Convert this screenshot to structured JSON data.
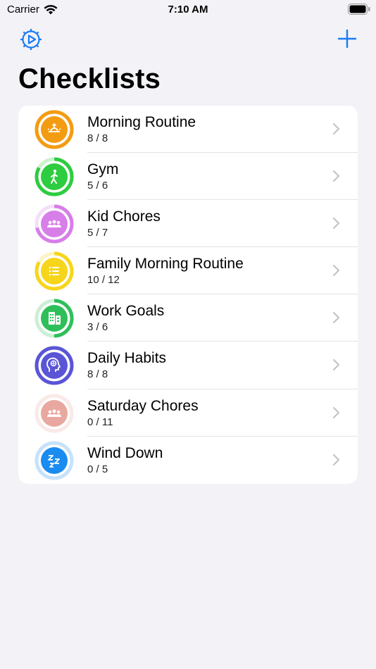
{
  "status": {
    "carrier": "Carrier",
    "time": "7:10 AM"
  },
  "nav": {
    "settings_icon": "gear-clock-icon",
    "add_icon": "plus-icon",
    "accent_color": "#1a7cf5"
  },
  "title": "Checklists",
  "checklists": [
    {
      "name": "Morning Routine",
      "count": "8 / 8",
      "done": 8,
      "total": 8,
      "color": "#f39c12",
      "icon": "sunrise-icon"
    },
    {
      "name": "Gym",
      "count": "5 / 6",
      "done": 5,
      "total": 6,
      "color": "#2ecc40",
      "icon": "walking-person-icon"
    },
    {
      "name": "Kid Chores",
      "count": "5 / 7",
      "done": 5,
      "total": 7,
      "color": "#d77ee8",
      "icon": "people-group-icon"
    },
    {
      "name": "Family Morning Routine",
      "count": "10 / 12",
      "done": 10,
      "total": 12,
      "color": "#f7d51a",
      "icon": "list-icon"
    },
    {
      "name": "Work Goals",
      "count": "3 / 6",
      "done": 3,
      "total": 6,
      "color": "#2fbf5a",
      "icon": "building-icon"
    },
    {
      "name": "Daily Habits",
      "count": "8 / 8",
      "done": 8,
      "total": 8,
      "color": "#5a55d6",
      "icon": "brain-head-icon"
    },
    {
      "name": "Saturday Chores",
      "count": "0 / 11",
      "done": 0,
      "total": 11,
      "color": "#e8a8a0",
      "icon": "people-group-icon"
    },
    {
      "name": "Wind Down",
      "count": "0 / 5",
      "done": 0,
      "total": 5,
      "color": "#1a8cf0",
      "icon": "sleep-zzz-icon"
    }
  ]
}
